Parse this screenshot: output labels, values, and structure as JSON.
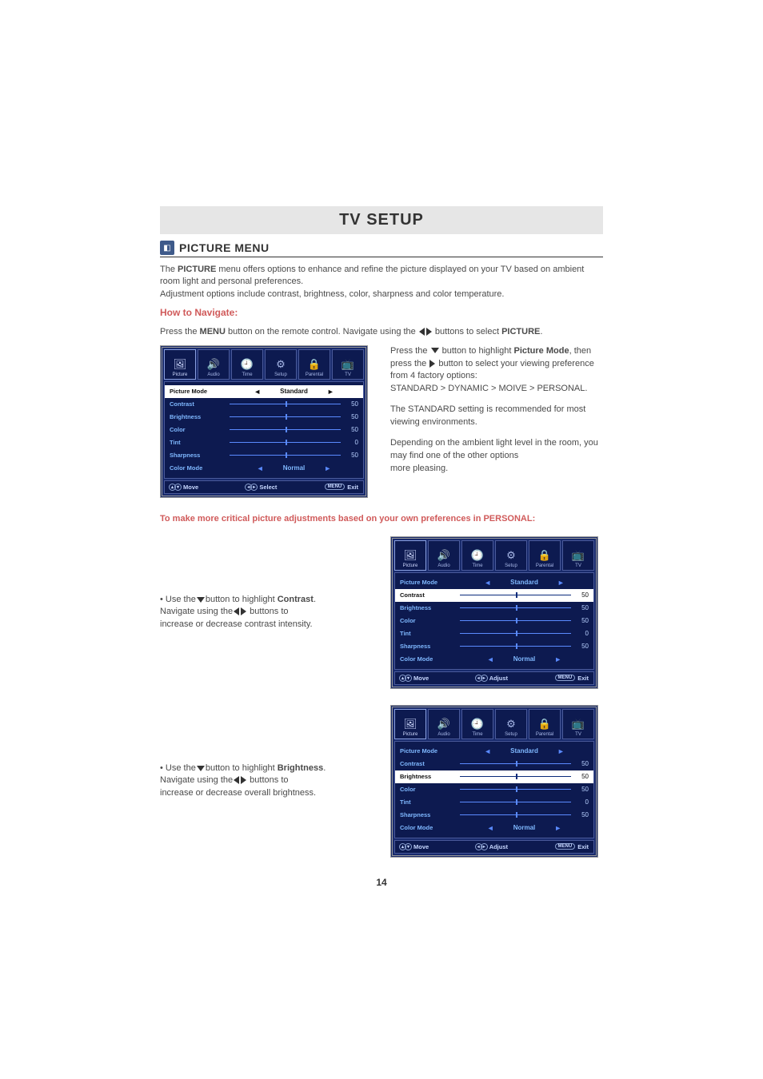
{
  "title": "TV SETUP",
  "section": {
    "title": "PICTURE MENU"
  },
  "intro": {
    "p1a": "The ",
    "p1b": "PICTURE",
    "p1c": " menu offers options to enhance and refine the picture displayed on your TV based on ambient room light and personal preferences.",
    "p2": "Adjustment options include contrast, brightness, color, sharpness and color temperature."
  },
  "howto": "How to Navigate:",
  "nav_line": {
    "a": "Press the ",
    "b": "MENU",
    "c": " button on the remote control. Navigate using the",
    "d": "buttons to select ",
    "e": "PICTURE",
    "f": "."
  },
  "rtext": {
    "p1a": "Press the",
    "p1b": "button to highlight ",
    "p1c": "Picture Mode",
    "p1d": ", then press the",
    "p1e": " button to select your viewing preference from 4 factory options:",
    "p1f": "STANDARD > DYNAMIC > MOIVE > PERSONAL.",
    "p2": "The STANDARD setting is recommended for most viewing environments.",
    "p3": "Depending on the ambient light level in the room, you may find one of the other options",
    "p4": "more pleasing."
  },
  "critical": "To make more critical picture adjustments based on your own preferences in PERSONAL:",
  "contrast_block": {
    "a": "• Use the",
    "b": "button to highlight ",
    "c": "Contrast",
    "d": ".",
    "e": "Navigate using the",
    "f": " buttons to",
    "g": " increase or decrease contrast intensity."
  },
  "brightness_block": {
    "a": "• Use the",
    "b": "button to highlight ",
    "c": "Brightness",
    "d": ".",
    "e": "Navigate using the",
    "f": " buttons to",
    "g": "increase or decrease overall brightness."
  },
  "tabs": [
    "Picture",
    "Audio",
    "Time",
    "Setup",
    "Parental",
    "TV"
  ],
  "tab_icons": [
    "🖼",
    "🔊",
    "🕘",
    "⚙",
    "🔒",
    "📺"
  ],
  "osd_rows": [
    {
      "label": "Picture Mode",
      "type": "select",
      "value": "Standard"
    },
    {
      "label": "Contrast",
      "type": "slider",
      "value": 50,
      "pos": 50
    },
    {
      "label": "Brightness",
      "type": "slider",
      "value": 50,
      "pos": 50
    },
    {
      "label": "Color",
      "type": "slider",
      "value": 50,
      "pos": 50
    },
    {
      "label": "Tint",
      "type": "slider",
      "value": 0,
      "pos": 50
    },
    {
      "label": "Sharpness",
      "type": "slider",
      "value": 50,
      "pos": 50
    },
    {
      "label": "Color Mode",
      "type": "select",
      "value": "Normal"
    }
  ],
  "footer": {
    "move": "Move",
    "select": "Select",
    "adjust": "Adjust",
    "exit": "Exit",
    "menu": "MENU"
  },
  "page_num": "14"
}
